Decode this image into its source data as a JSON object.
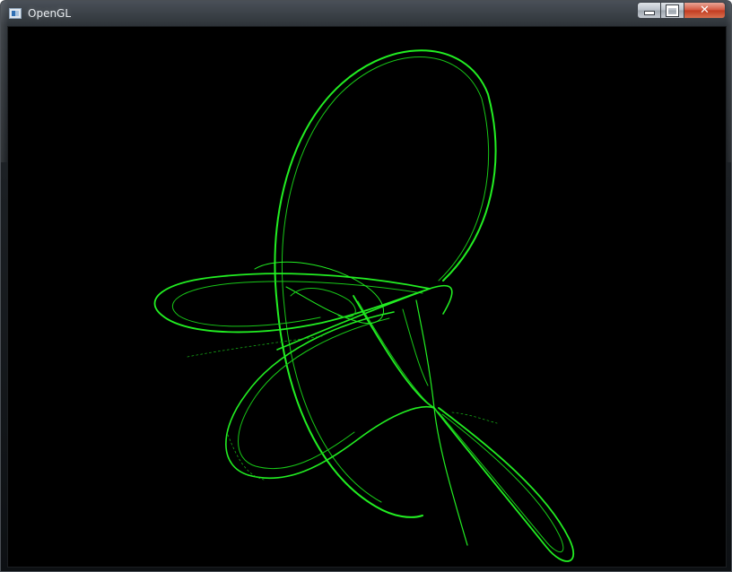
{
  "window": {
    "title": "OpenGL",
    "app_icon": "window-app-icon",
    "buttons": {
      "minimize_icon": "minimize-icon",
      "maximize_icon": "maximize-icon",
      "close_label": "✕"
    }
  },
  "canvas": {
    "background": "#000000",
    "stroke_color": "#22ee22"
  }
}
